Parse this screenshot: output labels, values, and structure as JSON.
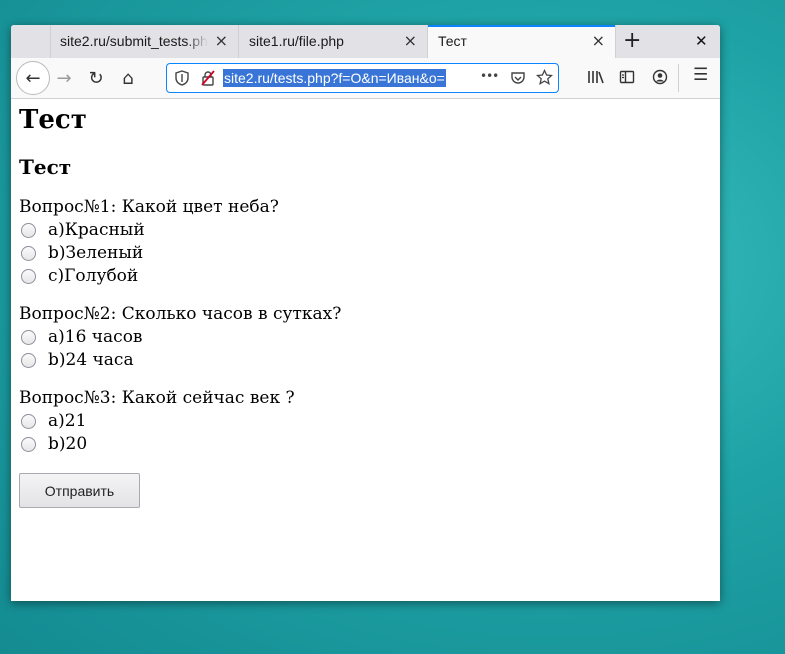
{
  "tabs": [
    {
      "title": "site2.ru/submit_tests.php"
    },
    {
      "title": "site1.ru/file.php"
    },
    {
      "title": "Тест"
    }
  ],
  "icons": {
    "tab_close": "×",
    "new_tab": "+",
    "window_close": "✕",
    "back": "←",
    "forward": "→",
    "reload": "↻",
    "home": "⌂",
    "more": "•••",
    "menu": "☰"
  },
  "address": {
    "url": "site2.ru/tests.php?f=O&n=Иван&o="
  },
  "page": {
    "h1": "Тест",
    "h2": "Тест",
    "questions": [
      {
        "text": "Вопрос№1: Какой цвет неба?",
        "options": [
          "а)Красный",
          "b)Зеленый",
          "с)Голубой"
        ]
      },
      {
        "text": "Вопрос№2: Сколько часов в сутках?",
        "options": [
          "а)16 часов",
          "b)24 часа"
        ]
      },
      {
        "text": "Вопрос№3: Какой сейчас век ?",
        "options": [
          "а)21",
          "b)20"
        ]
      }
    ],
    "submit_label": "Отправить"
  },
  "colors": {
    "accent": "#0a84ff",
    "url_selection": "#3875d7"
  }
}
